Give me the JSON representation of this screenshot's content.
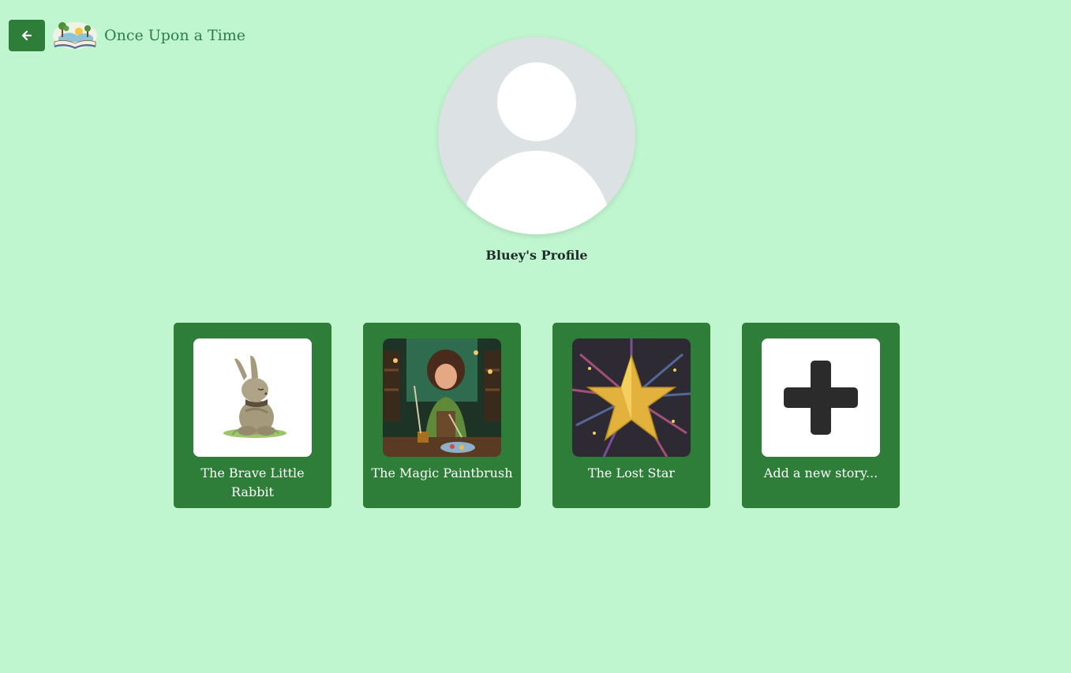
{
  "header": {
    "back_icon": "arrow-left-icon",
    "logo_icon": "open-book-landscape-logo",
    "title": "Once Upon a Time"
  },
  "profile": {
    "avatar_icon": "default-user-avatar-icon",
    "title": "Bluey's Profile"
  },
  "stories": [
    {
      "title": "The Brave Little Rabbit",
      "thumbnail": "rabbit-illustration"
    },
    {
      "title": "The Magic Paintbrush",
      "thumbnail": "girl-painting-illustration"
    },
    {
      "title": "The Lost Star",
      "thumbnail": "gold-star-illustration"
    }
  ],
  "add_story": {
    "label": "Add a new story...",
    "icon": "plus-icon"
  },
  "colors": {
    "background": "#c0f6cf",
    "accent": "#2e7d38",
    "title_text": "#2e7d4a"
  }
}
